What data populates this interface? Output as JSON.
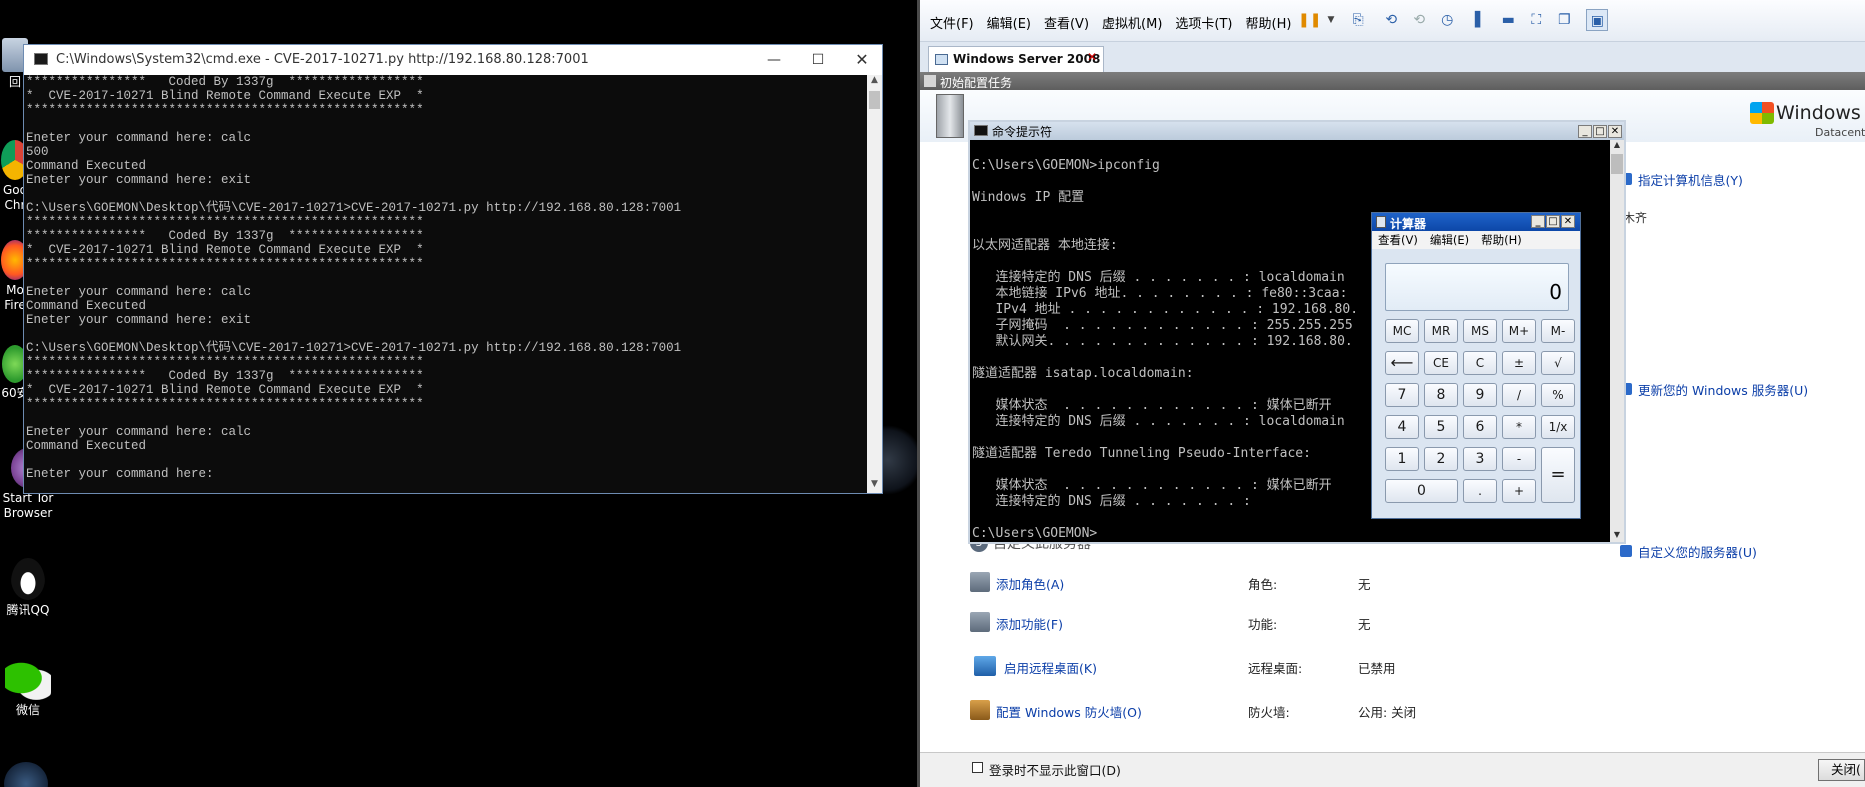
{
  "desktop": {
    "icons": [
      {
        "label": "回"
      },
      {
        "label": "Goo\nChr"
      },
      {
        "label": "Mo\nFire"
      },
      {
        "label": "60安"
      },
      {
        "label": "Start Tor\nBrowser"
      },
      {
        "label": "腾讯QQ"
      },
      {
        "label": "微信"
      }
    ]
  },
  "host_cmd": {
    "title": "C:\\Windows\\System32\\cmd.exe - CVE-2017-10271.py  http://192.168.80.128:7001",
    "lines": [
      "****************   Coded By 1337g  ******************",
      "*  CVE-2017-10271 Blind Remote Command Execute EXP  *",
      "*****************************************************",
      "",
      "Eneter your command here: calc",
      "500",
      "Command Executed",
      "Eneter your command here: exit",
      "",
      "C:\\Users\\GOEMON\\Desktop\\代码\\CVE-2017-10271>CVE-2017-10271.py http://192.168.80.128:7001",
      "*****************************************************",
      "****************   Coded By 1337g  ******************",
      "*  CVE-2017-10271 Blind Remote Command Execute EXP  *",
      "*****************************************************",
      "",
      "Eneter your command here: calc",
      "Command Executed",
      "Eneter your command here: exit",
      "",
      "C:\\Users\\GOEMON\\Desktop\\代码\\CVE-2017-10271>CVE-2017-10271.py http://192.168.80.128:7001",
      "*****************************************************",
      "****************   Coded By 1337g  ******************",
      "*  CVE-2017-10271 Blind Remote Command Execute EXP  *",
      "*****************************************************",
      "",
      "Eneter your command here: calc",
      "Command Executed",
      "",
      "Eneter your command here:"
    ]
  },
  "vmware": {
    "menu": [
      "文件(F)",
      "编辑(E)",
      "查看(V)",
      "虚拟机(M)",
      "选项卡(T)",
      "帮助(H)"
    ],
    "tab": "Windows Server 2008",
    "task_strip": "初始配置任务",
    "logo": {
      "brand": "Windows Ser",
      "edition": "Datacenter"
    },
    "guest_cmd": {
      "title": "命令提示符",
      "lines": [
        "C:\\Users\\GOEMON>ipconfig",
        "",
        "Windows IP 配置",
        "",
        "",
        "以太网适配器 本地连接:",
        "",
        "   连接特定的 DNS 后缀 . . . . . . . : localdomain",
        "   本地链接 IPv6 地址. . . . . . . . : fe80::3caa:",
        "   IPv4 地址 . . . . . . . . . . . . : 192.168.80.",
        "   子网掩码  . . . . . . . . . . . . : 255.255.255",
        "   默认网关. . . . . . . . . . . . . : 192.168.80.",
        "",
        "隧道适配器 isatap.localdomain:",
        "",
        "   媒体状态  . . . . . . . . . . . . : 媒体已断开",
        "   连接特定的 DNS 后缀 . . . . . . . : localdomain",
        "",
        "隧道适配器 Teredo Tunneling Pseudo-Interface:",
        "",
        "   媒体状态  . . . . . . . . . . . . : 媒体已断开",
        "   连接特定的 DNS 后缀 . . . . . . . :",
        "",
        "C:\\Users\\GOEMON>"
      ]
    },
    "calculator": {
      "title": "计算器",
      "menu": [
        "查看(V)",
        "编辑(E)",
        "帮助(H)"
      ],
      "display": "0",
      "keys": {
        "mc": "MC",
        "mr": "MR",
        "ms": "MS",
        "mplus": "M+",
        "mminus": "M-",
        "back": "⟵",
        "ce": "CE",
        "c": "C",
        "pm": "±",
        "sqrt": "√",
        "k7": "7",
        "k8": "8",
        "k9": "9",
        "div": "/",
        "pct": "%",
        "k4": "4",
        "k5": "5",
        "k6": "6",
        "mul": "*",
        "inv": "1/x",
        "k1": "1",
        "k2": "2",
        "k3": "3",
        "sub": "-",
        "eq": "=",
        "k0": "0",
        "dot": ".",
        "add": "+"
      }
    },
    "side_links": {
      "computer_info": "指定计算机信息(Y)",
      "update_server": "更新您的 Windows 服务器(U)",
      "customize_server": "自定义您的服务器(U)",
      "urumqi_fragment": "木齐"
    },
    "customize": {
      "heading": "自定义此服务器",
      "rows": [
        {
          "action": "添加角色(A)",
          "label": "角色:",
          "value": "无"
        },
        {
          "action": "添加功能(F)",
          "label": "功能:",
          "value": "无"
        },
        {
          "action": "启用远程桌面(K)",
          "label": "远程桌面:",
          "value": "已禁用"
        },
        {
          "action": "配置 Windows 防火墙(O)",
          "label": "防火墙:",
          "value": "公用: 关闭"
        }
      ]
    },
    "footer": {
      "checkbox_label": "登录时不显示此窗口(D)",
      "close_button": "关闭("
    }
  }
}
